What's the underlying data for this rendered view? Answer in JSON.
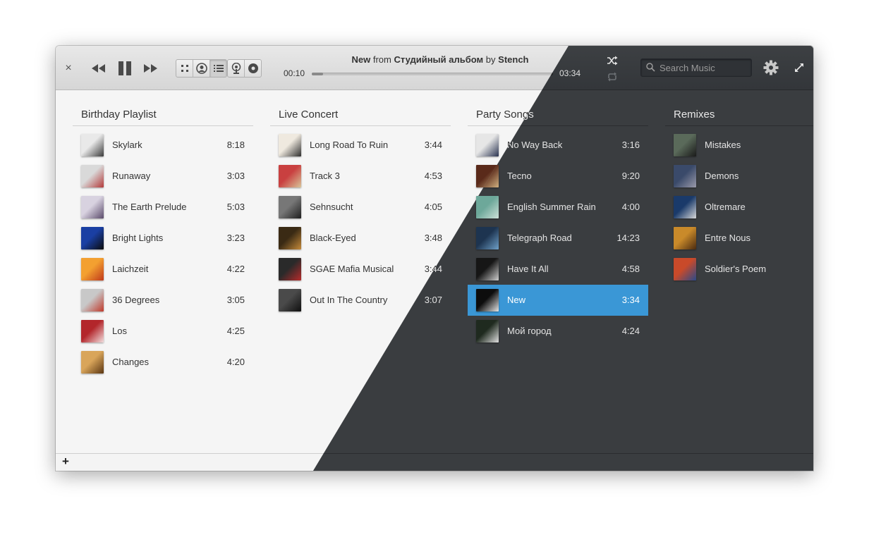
{
  "header": {
    "close_glyph": "×",
    "now_playing": {
      "title": "New",
      "from_word": "from",
      "album": "Студийный альбом",
      "by_word": "by",
      "artist": "Stench"
    },
    "elapsed": "00:10",
    "total": "03:34",
    "progress_fraction": 0.047,
    "search_placeholder": "Search Music",
    "view_mode_active": "list"
  },
  "columns": [
    {
      "title": "Birthday Playlist",
      "tracks": [
        {
          "name": "Skylark",
          "duration": "8:18",
          "art": [
            "#e9e9e9",
            "#3a3a3a"
          ]
        },
        {
          "name": "Runaway",
          "duration": "3:03",
          "art": [
            "#d9d9d9",
            "#b33a3a"
          ]
        },
        {
          "name": "The Earth Prelude",
          "duration": "5:03",
          "art": [
            "#d8d2e0",
            "#5a4a6a"
          ]
        },
        {
          "name": "Bright Lights",
          "duration": "3:23",
          "art": [
            "#1a3fa3",
            "#0b0b0b"
          ]
        },
        {
          "name": "Laichzeit",
          "duration": "4:22",
          "art": [
            "#f3a030",
            "#c0391b"
          ]
        },
        {
          "name": "36 Degrees",
          "duration": "3:05",
          "art": [
            "#c8c8c8",
            "#c0392b"
          ]
        },
        {
          "name": "Los",
          "duration": "4:25",
          "art": [
            "#b3262b",
            "#f2dede"
          ]
        },
        {
          "name": "Changes",
          "duration": "4:20",
          "art": [
            "#d9a55a",
            "#5a3512"
          ]
        }
      ]
    },
    {
      "title": "Live Concert",
      "tracks": [
        {
          "name": "Long Road To Ruin",
          "duration": "3:44",
          "art": [
            "#efe9df",
            "#2e2e2e"
          ]
        },
        {
          "name": "Track 3",
          "duration": "4:53",
          "art": [
            "#c94040",
            "#d8c59a"
          ]
        },
        {
          "name": "Sehnsucht",
          "duration": "4:05",
          "art": [
            "#777777",
            "#1e1e1e"
          ]
        },
        {
          "name": "Black-Eyed",
          "duration": "3:48",
          "art": [
            "#3a2a14",
            "#c58a3a"
          ]
        },
        {
          "name": "SGAE Mafia Musical",
          "duration": "3:44",
          "art": [
            "#2a2a2a",
            "#b72b2b"
          ]
        },
        {
          "name": "Out In The Country",
          "duration": "3:07",
          "art": [
            "#4a4a4a",
            "#0f0f0f"
          ]
        }
      ]
    },
    {
      "title": "Party Songs",
      "tracks": [
        {
          "name": "No Way Back",
          "duration": "3:16",
          "art": [
            "#e6e6e6",
            "#2a3350"
          ]
        },
        {
          "name": "Tecno",
          "duration": "9:20",
          "art": [
            "#5a2a1a",
            "#d0b080"
          ]
        },
        {
          "name": "English Summer Rain",
          "duration": "4:00",
          "art": [
            "#6da89a",
            "#cde1d9"
          ]
        },
        {
          "name": "Telegraph Road",
          "duration": "14:23",
          "art": [
            "#1d3450",
            "#6fa0c8"
          ]
        },
        {
          "name": "Have It All",
          "duration": "4:58",
          "art": [
            "#161616",
            "#cfcfcf"
          ]
        },
        {
          "name": "New",
          "duration": "3:34",
          "art": [
            "#0d0d0d",
            "#e6e6e6"
          ],
          "selected": true
        },
        {
          "name": "Мой город",
          "duration": "4:24",
          "art": [
            "#1f2a1f",
            "#e0e0e0"
          ]
        }
      ]
    },
    {
      "title": "Remixes",
      "tracks": [
        {
          "name": "Mistakes",
          "duration": "",
          "art": [
            "#5a6a5a",
            "#1a1a1a"
          ]
        },
        {
          "name": "Demons",
          "duration": "",
          "art": [
            "#3a4a6a",
            "#9a9aaa"
          ]
        },
        {
          "name": "Oltremare",
          "duration": "",
          "art": [
            "#1a3a6a",
            "#d8d8d8"
          ]
        },
        {
          "name": "Entre Nous",
          "duration": "",
          "art": [
            "#c98a2a",
            "#4a2a10"
          ]
        },
        {
          "name": "Soldier's Poem",
          "duration": "",
          "art": [
            "#c94a2a",
            "#2a4a8a"
          ]
        }
      ]
    }
  ],
  "footer": {
    "add_glyph": "+"
  },
  "colors": {
    "accent": "#3a97d6",
    "dark_bg": "#3a3d40",
    "light_bg": "#f5f5f5"
  }
}
